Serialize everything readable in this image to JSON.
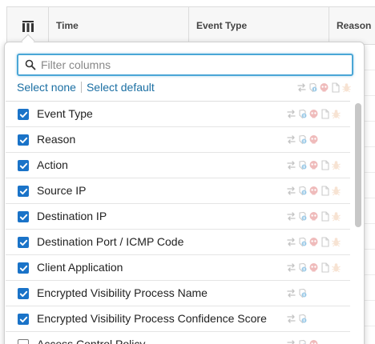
{
  "table": {
    "columns": [
      "Time",
      "Event Type",
      "Reason"
    ]
  },
  "popover": {
    "search": {
      "placeholder": "Filter columns",
      "value": ""
    },
    "select_none": "Select none",
    "select_default": "Select default",
    "items": [
      {
        "label": "Event Type",
        "checked": true,
        "icons": [
          "connection",
          "security",
          "intrusion",
          "file",
          "malware"
        ]
      },
      {
        "label": "Reason",
        "checked": true,
        "icons": [
          "connection",
          "security",
          "intrusion"
        ]
      },
      {
        "label": "Action",
        "checked": true,
        "icons": [
          "connection",
          "security",
          "intrusion",
          "file",
          "malware"
        ]
      },
      {
        "label": "Source IP",
        "checked": true,
        "icons": [
          "connection",
          "security",
          "intrusion",
          "file",
          "malware"
        ]
      },
      {
        "label": "Destination IP",
        "checked": true,
        "icons": [
          "connection",
          "security",
          "intrusion",
          "file",
          "malware"
        ]
      },
      {
        "label": "Destination Port / ICMP Code",
        "checked": true,
        "icons": [
          "connection",
          "security",
          "intrusion",
          "file",
          "malware"
        ]
      },
      {
        "label": "Client Application",
        "checked": true,
        "icons": [
          "connection",
          "security",
          "intrusion",
          "file",
          "malware"
        ]
      },
      {
        "label": "Encrypted Visibility Process Name",
        "checked": true,
        "icons": [
          "connection",
          "security"
        ]
      },
      {
        "label": "Encrypted Visibility Process Confidence Score",
        "checked": true,
        "icons": [
          "connection",
          "security"
        ]
      },
      {
        "label": "Access Control Policy",
        "checked": false,
        "icons": [
          "connection",
          "security",
          "intrusion"
        ]
      }
    ]
  },
  "colors": {
    "accent": "#1a73c8",
    "link": "#1b6fa3",
    "focus": "#4aa6d6"
  }
}
